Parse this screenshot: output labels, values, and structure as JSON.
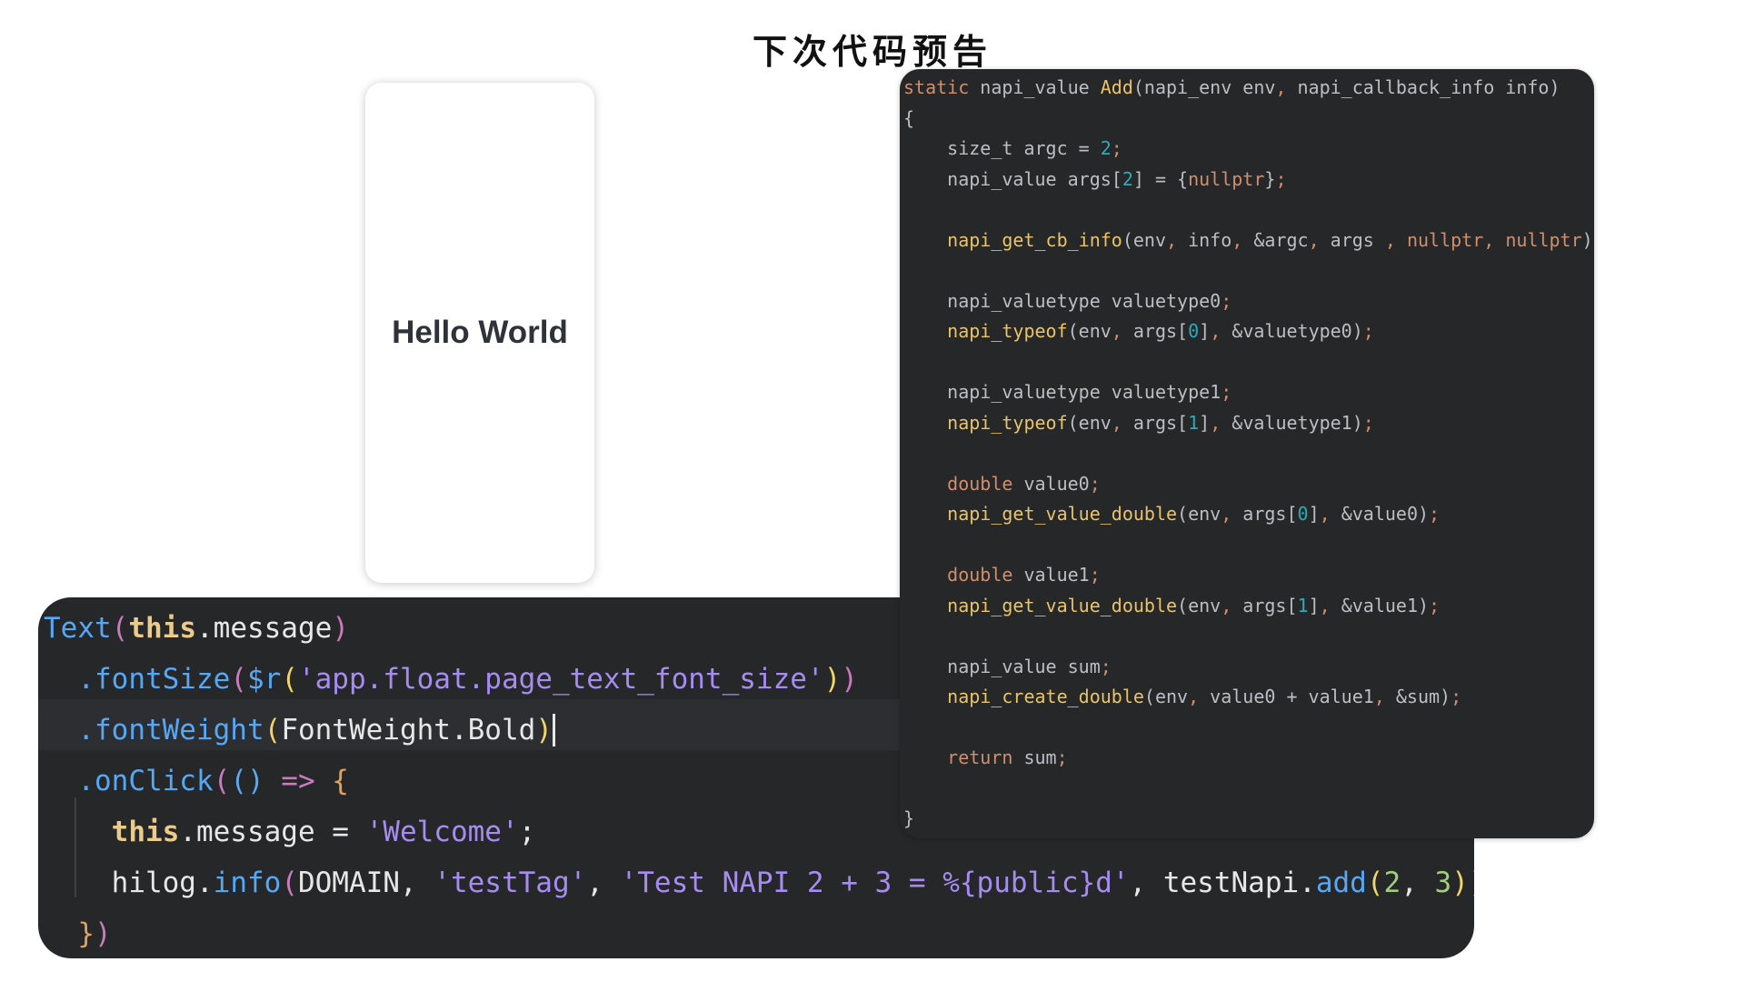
{
  "slide": {
    "title": "下次代码预告"
  },
  "preview": {
    "text": "Hello World"
  },
  "ui_code": {
    "l1_text": "Text",
    "l1_p1": "(",
    "l1_this": "this",
    "l1_dot": ".",
    "l1_message": "message",
    "l1_p2": ")",
    "l2_indent": "  ",
    "l2_method": ".fontSize",
    "l2_p1": "(",
    "l2_fn": "$r",
    "l2_p2": "(",
    "l2_str": "'app.float.page_text_font_size'",
    "l2_p3": ")",
    "l2_p4": ")",
    "l3_indent": "  ",
    "l3_method": ".fontWeight",
    "l3_p1": "(",
    "l3_arg": "FontWeight.Bold",
    "l3_p2": ")",
    "l4_indent": "  ",
    "l4_method": ".onClick",
    "l4_p1": "(",
    "l4_p2": "()",
    "l4_arrow": " => ",
    "l4_brace": "{",
    "l5_indent": "    ",
    "l5_this": "this",
    "l5_dot": ".",
    "l5_message": "message",
    "l5_eq": " = ",
    "l5_str": "'Welcome'",
    "l5_semi": ";",
    "l6_indent": "    ",
    "l6_obj": "hilog",
    "l6_dot": ".",
    "l6_method": "info",
    "l6_p1": "(",
    "l6_domain": "DOMAIN",
    "l6_c1": ", ",
    "l6_tag": "'testTag'",
    "l6_c2": ", ",
    "l6_fmt": "'Test NAPI 2 + 3 = %{public}d'",
    "l6_c3": ", ",
    "l6_napi": "testNapi",
    "l6_dot2": ".",
    "l6_add": "add",
    "l6_p2": "(",
    "l6_n1": "2",
    "l6_c4": ", ",
    "l6_n2": "3",
    "l6_p3": ")",
    "l6_p4": ")",
    "l6_semi": ";",
    "l7_indent": "  ",
    "l7_brace": "}",
    "l7_paren": ")"
  },
  "napi_code": {
    "l1_static": "static",
    "l1_sig_a": " napi_value ",
    "l1_name": "Add",
    "l1_sig_b": "(napi_env env",
    "l1_comma": ",",
    "l1_sig_c": " napi_callback_info info)",
    "l2": "{",
    "l3_a": "    size_t argc = ",
    "l3_num": "2",
    "l3_semi": ";",
    "l4_a": "    napi_value args[",
    "l4_num": "2",
    "l4_b": "] = {",
    "l4_null": "nullptr",
    "l4_c": "}",
    "l4_semi": ";",
    "l6_indent": "    ",
    "l6_fn": "napi_get_cb_info",
    "l6_a": "(env",
    "l6_c1": ",",
    "l6_b": " info",
    "l6_c2": ",",
    "l6_c": " &argc",
    "l6_c3": ",",
    "l6_d": " args ",
    "l6_c4": ",",
    "l6_n1": " nullptr",
    "l6_c5": ",",
    "l6_n2": " nullptr",
    "l6_e": ")",
    "l6_semi": ";",
    "l8_a": "    napi_valuetype valuetype0",
    "l8_semi": ";",
    "l9_indent": "    ",
    "l9_fn": "napi_typeof",
    "l9_a": "(env",
    "l9_c1": ",",
    "l9_b": " args[",
    "l9_num": "0",
    "l9_c": "]",
    "l9_c2": ",",
    "l9_d": " &valuetype0)",
    "l9_semi": ";",
    "l11_a": "    napi_valuetype valuetype1",
    "l11_semi": ";",
    "l12_indent": "    ",
    "l12_fn": "napi_typeof",
    "l12_a": "(env",
    "l12_c1": ",",
    "l12_b": " args[",
    "l12_num": "1",
    "l12_c": "]",
    "l12_c2": ",",
    "l12_d": " &valuetype1)",
    "l12_semi": ";",
    "l14_indent": "    ",
    "l14_kw": "double",
    "l14_a": " value0",
    "l14_semi": ";",
    "l15_indent": "    ",
    "l15_fn": "napi_get_value_double",
    "l15_a": "(env",
    "l15_c1": ",",
    "l15_b": " args[",
    "l15_num": "0",
    "l15_c": "]",
    "l15_c2": ",",
    "l15_d": " &value0)",
    "l15_semi": ";",
    "l17_indent": "    ",
    "l17_kw": "double",
    "l17_a": " value1",
    "l17_semi": ";",
    "l18_indent": "    ",
    "l18_fn": "napi_get_value_double",
    "l18_a": "(env",
    "l18_c1": ",",
    "l18_b": " args[",
    "l18_num": "1",
    "l18_c": "]",
    "l18_c2": ",",
    "l18_d": " &value1)",
    "l18_semi": ";",
    "l20_a": "    napi_value sum",
    "l20_semi": ";",
    "l21_indent": "    ",
    "l21_fn": "napi_create_double",
    "l21_a": "(env",
    "l21_c1": ",",
    "l21_b": " value0 + value1",
    "l21_c2": ",",
    "l21_c": " &sum)",
    "l21_semi": ";",
    "l23_indent": "    ",
    "l23_kw": "return",
    "l23_a": " sum",
    "l23_semi": ";",
    "l25": "}"
  }
}
